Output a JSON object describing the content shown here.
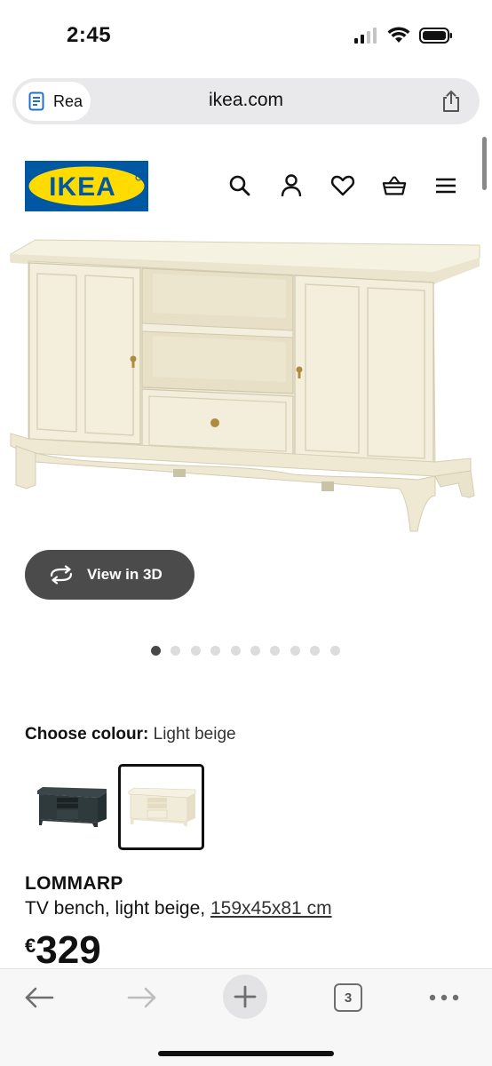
{
  "status_bar": {
    "time": "2:45"
  },
  "browser": {
    "reader_label": "Rea",
    "url": "ikea.com",
    "open_tabs": "3"
  },
  "site": {
    "logo_text": "IKEA"
  },
  "gallery": {
    "view_3d_label": "View in 3D",
    "image_count": 10,
    "active_index": 0
  },
  "product": {
    "colour_label": "Choose colour:",
    "colour_value": "Light beige",
    "name": "LOMMARP",
    "description": "TV bench, light beige,",
    "dimensions": "159x45x81 cm",
    "currency": "€",
    "price": "329"
  },
  "colors": {
    "ikea_blue": "#0058a3",
    "ikea_yellow": "#ffdb00",
    "button_dark": "#4b4b4b",
    "furniture_beige": "#f1ecd9",
    "furniture_dark": "#2f3a3c"
  },
  "icons": [
    "reader-icon",
    "share-icon",
    "search-icon",
    "user-icon",
    "heart-icon",
    "basket-icon",
    "menu-icon",
    "rotate-3d-icon",
    "back-arrow-icon",
    "forward-arrow-icon",
    "plus-icon",
    "more-icon"
  ]
}
